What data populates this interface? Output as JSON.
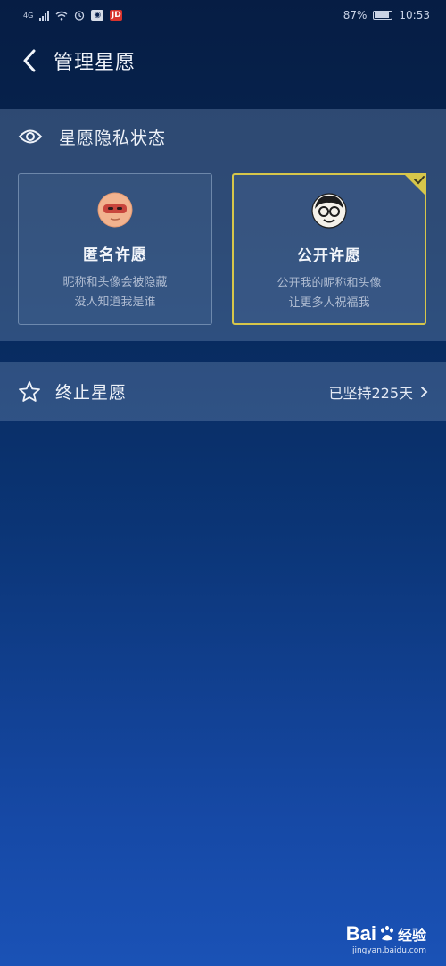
{
  "status_bar": {
    "network_label": "4G",
    "app_badge_red": "JD",
    "battery_percent": "87%",
    "time": "10:53"
  },
  "header": {
    "title": "管理星愿"
  },
  "privacy": {
    "section_title": "星愿隐私状态",
    "selected": "public",
    "options": [
      {
        "id": "anonymous",
        "title": "匿名许愿",
        "desc_line1": "昵称和头像会被隐藏",
        "desc_line2": "没人知道我是谁"
      },
      {
        "id": "public",
        "title": "公开许愿",
        "desc_line1": "公开我的昵称和头像",
        "desc_line2": "让更多人祝福我"
      }
    ]
  },
  "terminate": {
    "label": "终止星愿",
    "status": "已坚持225天"
  },
  "watermark": {
    "brand_left": "Bai",
    "brand_right": "经验",
    "url": "jingyan.baidu.com"
  },
  "colors": {
    "accent_selected": "#d6c64a",
    "background_top": "#061d44",
    "background_bottom": "#1a52b6"
  }
}
